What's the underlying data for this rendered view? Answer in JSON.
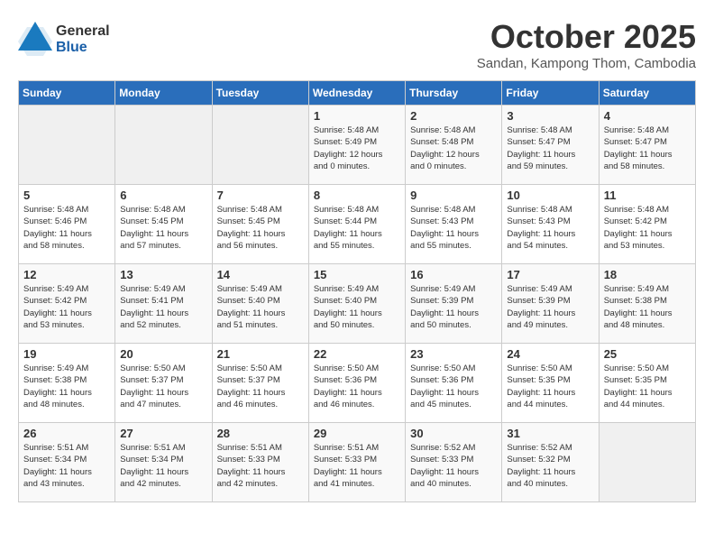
{
  "header": {
    "logo_general": "General",
    "logo_blue": "Blue",
    "month": "October 2025",
    "location": "Sandan, Kampong Thom, Cambodia"
  },
  "days_of_week": [
    "Sunday",
    "Monday",
    "Tuesday",
    "Wednesday",
    "Thursday",
    "Friday",
    "Saturday"
  ],
  "weeks": [
    [
      {
        "day": "",
        "info": ""
      },
      {
        "day": "",
        "info": ""
      },
      {
        "day": "",
        "info": ""
      },
      {
        "day": "1",
        "info": "Sunrise: 5:48 AM\nSunset: 5:49 PM\nDaylight: 12 hours\nand 0 minutes."
      },
      {
        "day": "2",
        "info": "Sunrise: 5:48 AM\nSunset: 5:48 PM\nDaylight: 12 hours\nand 0 minutes."
      },
      {
        "day": "3",
        "info": "Sunrise: 5:48 AM\nSunset: 5:47 PM\nDaylight: 11 hours\nand 59 minutes."
      },
      {
        "day": "4",
        "info": "Sunrise: 5:48 AM\nSunset: 5:47 PM\nDaylight: 11 hours\nand 58 minutes."
      }
    ],
    [
      {
        "day": "5",
        "info": "Sunrise: 5:48 AM\nSunset: 5:46 PM\nDaylight: 11 hours\nand 58 minutes."
      },
      {
        "day": "6",
        "info": "Sunrise: 5:48 AM\nSunset: 5:45 PM\nDaylight: 11 hours\nand 57 minutes."
      },
      {
        "day": "7",
        "info": "Sunrise: 5:48 AM\nSunset: 5:45 PM\nDaylight: 11 hours\nand 56 minutes."
      },
      {
        "day": "8",
        "info": "Sunrise: 5:48 AM\nSunset: 5:44 PM\nDaylight: 11 hours\nand 55 minutes."
      },
      {
        "day": "9",
        "info": "Sunrise: 5:48 AM\nSunset: 5:43 PM\nDaylight: 11 hours\nand 55 minutes."
      },
      {
        "day": "10",
        "info": "Sunrise: 5:48 AM\nSunset: 5:43 PM\nDaylight: 11 hours\nand 54 minutes."
      },
      {
        "day": "11",
        "info": "Sunrise: 5:48 AM\nSunset: 5:42 PM\nDaylight: 11 hours\nand 53 minutes."
      }
    ],
    [
      {
        "day": "12",
        "info": "Sunrise: 5:49 AM\nSunset: 5:42 PM\nDaylight: 11 hours\nand 53 minutes."
      },
      {
        "day": "13",
        "info": "Sunrise: 5:49 AM\nSunset: 5:41 PM\nDaylight: 11 hours\nand 52 minutes."
      },
      {
        "day": "14",
        "info": "Sunrise: 5:49 AM\nSunset: 5:40 PM\nDaylight: 11 hours\nand 51 minutes."
      },
      {
        "day": "15",
        "info": "Sunrise: 5:49 AM\nSunset: 5:40 PM\nDaylight: 11 hours\nand 50 minutes."
      },
      {
        "day": "16",
        "info": "Sunrise: 5:49 AM\nSunset: 5:39 PM\nDaylight: 11 hours\nand 50 minutes."
      },
      {
        "day": "17",
        "info": "Sunrise: 5:49 AM\nSunset: 5:39 PM\nDaylight: 11 hours\nand 49 minutes."
      },
      {
        "day": "18",
        "info": "Sunrise: 5:49 AM\nSunset: 5:38 PM\nDaylight: 11 hours\nand 48 minutes."
      }
    ],
    [
      {
        "day": "19",
        "info": "Sunrise: 5:49 AM\nSunset: 5:38 PM\nDaylight: 11 hours\nand 48 minutes."
      },
      {
        "day": "20",
        "info": "Sunrise: 5:50 AM\nSunset: 5:37 PM\nDaylight: 11 hours\nand 47 minutes."
      },
      {
        "day": "21",
        "info": "Sunrise: 5:50 AM\nSunset: 5:37 PM\nDaylight: 11 hours\nand 46 minutes."
      },
      {
        "day": "22",
        "info": "Sunrise: 5:50 AM\nSunset: 5:36 PM\nDaylight: 11 hours\nand 46 minutes."
      },
      {
        "day": "23",
        "info": "Sunrise: 5:50 AM\nSunset: 5:36 PM\nDaylight: 11 hours\nand 45 minutes."
      },
      {
        "day": "24",
        "info": "Sunrise: 5:50 AM\nSunset: 5:35 PM\nDaylight: 11 hours\nand 44 minutes."
      },
      {
        "day": "25",
        "info": "Sunrise: 5:50 AM\nSunset: 5:35 PM\nDaylight: 11 hours\nand 44 minutes."
      }
    ],
    [
      {
        "day": "26",
        "info": "Sunrise: 5:51 AM\nSunset: 5:34 PM\nDaylight: 11 hours\nand 43 minutes."
      },
      {
        "day": "27",
        "info": "Sunrise: 5:51 AM\nSunset: 5:34 PM\nDaylight: 11 hours\nand 42 minutes."
      },
      {
        "day": "28",
        "info": "Sunrise: 5:51 AM\nSunset: 5:33 PM\nDaylight: 11 hours\nand 42 minutes."
      },
      {
        "day": "29",
        "info": "Sunrise: 5:51 AM\nSunset: 5:33 PM\nDaylight: 11 hours\nand 41 minutes."
      },
      {
        "day": "30",
        "info": "Sunrise: 5:52 AM\nSunset: 5:33 PM\nDaylight: 11 hours\nand 40 minutes."
      },
      {
        "day": "31",
        "info": "Sunrise: 5:52 AM\nSunset: 5:32 PM\nDaylight: 11 hours\nand 40 minutes."
      },
      {
        "day": "",
        "info": ""
      }
    ]
  ]
}
